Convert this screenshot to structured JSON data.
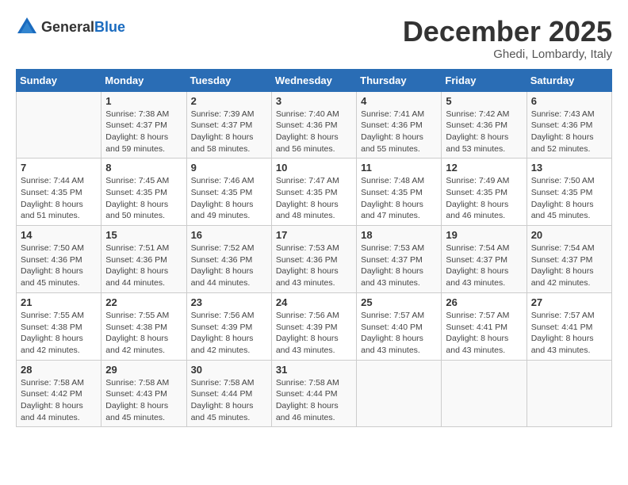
{
  "logo": {
    "general": "General",
    "blue": "Blue"
  },
  "title": {
    "month_year": "December 2025",
    "location": "Ghedi, Lombardy, Italy"
  },
  "weekdays": [
    "Sunday",
    "Monday",
    "Tuesday",
    "Wednesday",
    "Thursday",
    "Friday",
    "Saturday"
  ],
  "weeks": [
    [
      {
        "day": "",
        "info": ""
      },
      {
        "day": "1",
        "info": "Sunrise: 7:38 AM\nSunset: 4:37 PM\nDaylight: 8 hours\nand 59 minutes."
      },
      {
        "day": "2",
        "info": "Sunrise: 7:39 AM\nSunset: 4:37 PM\nDaylight: 8 hours\nand 58 minutes."
      },
      {
        "day": "3",
        "info": "Sunrise: 7:40 AM\nSunset: 4:36 PM\nDaylight: 8 hours\nand 56 minutes."
      },
      {
        "day": "4",
        "info": "Sunrise: 7:41 AM\nSunset: 4:36 PM\nDaylight: 8 hours\nand 55 minutes."
      },
      {
        "day": "5",
        "info": "Sunrise: 7:42 AM\nSunset: 4:36 PM\nDaylight: 8 hours\nand 53 minutes."
      },
      {
        "day": "6",
        "info": "Sunrise: 7:43 AM\nSunset: 4:36 PM\nDaylight: 8 hours\nand 52 minutes."
      }
    ],
    [
      {
        "day": "7",
        "info": "Sunrise: 7:44 AM\nSunset: 4:35 PM\nDaylight: 8 hours\nand 51 minutes."
      },
      {
        "day": "8",
        "info": "Sunrise: 7:45 AM\nSunset: 4:35 PM\nDaylight: 8 hours\nand 50 minutes."
      },
      {
        "day": "9",
        "info": "Sunrise: 7:46 AM\nSunset: 4:35 PM\nDaylight: 8 hours\nand 49 minutes."
      },
      {
        "day": "10",
        "info": "Sunrise: 7:47 AM\nSunset: 4:35 PM\nDaylight: 8 hours\nand 48 minutes."
      },
      {
        "day": "11",
        "info": "Sunrise: 7:48 AM\nSunset: 4:35 PM\nDaylight: 8 hours\nand 47 minutes."
      },
      {
        "day": "12",
        "info": "Sunrise: 7:49 AM\nSunset: 4:35 PM\nDaylight: 8 hours\nand 46 minutes."
      },
      {
        "day": "13",
        "info": "Sunrise: 7:50 AM\nSunset: 4:35 PM\nDaylight: 8 hours\nand 45 minutes."
      }
    ],
    [
      {
        "day": "14",
        "info": "Sunrise: 7:50 AM\nSunset: 4:36 PM\nDaylight: 8 hours\nand 45 minutes."
      },
      {
        "day": "15",
        "info": "Sunrise: 7:51 AM\nSunset: 4:36 PM\nDaylight: 8 hours\nand 44 minutes."
      },
      {
        "day": "16",
        "info": "Sunrise: 7:52 AM\nSunset: 4:36 PM\nDaylight: 8 hours\nand 44 minutes."
      },
      {
        "day": "17",
        "info": "Sunrise: 7:53 AM\nSunset: 4:36 PM\nDaylight: 8 hours\nand 43 minutes."
      },
      {
        "day": "18",
        "info": "Sunrise: 7:53 AM\nSunset: 4:37 PM\nDaylight: 8 hours\nand 43 minutes."
      },
      {
        "day": "19",
        "info": "Sunrise: 7:54 AM\nSunset: 4:37 PM\nDaylight: 8 hours\nand 43 minutes."
      },
      {
        "day": "20",
        "info": "Sunrise: 7:54 AM\nSunset: 4:37 PM\nDaylight: 8 hours\nand 42 minutes."
      }
    ],
    [
      {
        "day": "21",
        "info": "Sunrise: 7:55 AM\nSunset: 4:38 PM\nDaylight: 8 hours\nand 42 minutes."
      },
      {
        "day": "22",
        "info": "Sunrise: 7:55 AM\nSunset: 4:38 PM\nDaylight: 8 hours\nand 42 minutes."
      },
      {
        "day": "23",
        "info": "Sunrise: 7:56 AM\nSunset: 4:39 PM\nDaylight: 8 hours\nand 42 minutes."
      },
      {
        "day": "24",
        "info": "Sunrise: 7:56 AM\nSunset: 4:39 PM\nDaylight: 8 hours\nand 43 minutes."
      },
      {
        "day": "25",
        "info": "Sunrise: 7:57 AM\nSunset: 4:40 PM\nDaylight: 8 hours\nand 43 minutes."
      },
      {
        "day": "26",
        "info": "Sunrise: 7:57 AM\nSunset: 4:41 PM\nDaylight: 8 hours\nand 43 minutes."
      },
      {
        "day": "27",
        "info": "Sunrise: 7:57 AM\nSunset: 4:41 PM\nDaylight: 8 hours\nand 43 minutes."
      }
    ],
    [
      {
        "day": "28",
        "info": "Sunrise: 7:58 AM\nSunset: 4:42 PM\nDaylight: 8 hours\nand 44 minutes."
      },
      {
        "day": "29",
        "info": "Sunrise: 7:58 AM\nSunset: 4:43 PM\nDaylight: 8 hours\nand 45 minutes."
      },
      {
        "day": "30",
        "info": "Sunrise: 7:58 AM\nSunset: 4:44 PM\nDaylight: 8 hours\nand 45 minutes."
      },
      {
        "day": "31",
        "info": "Sunrise: 7:58 AM\nSunset: 4:44 PM\nDaylight: 8 hours\nand 46 minutes."
      },
      {
        "day": "",
        "info": ""
      },
      {
        "day": "",
        "info": ""
      },
      {
        "day": "",
        "info": ""
      }
    ]
  ]
}
